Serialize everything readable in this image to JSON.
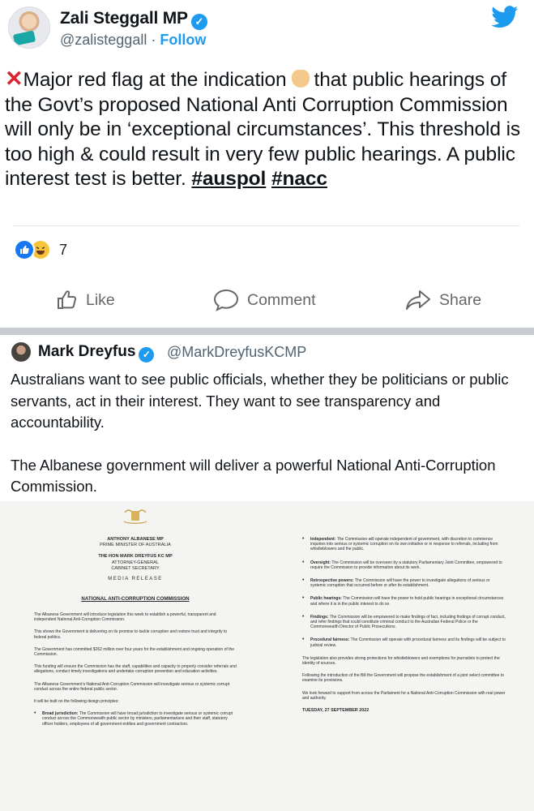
{
  "tweet1": {
    "author_name": "Zali Steggall MP",
    "handle": "@zalisteggall",
    "separator": "·",
    "follow_label": "Follow",
    "text_prefix": "Major red flag at the indication",
    "text_main": "that public hearings of the Govt’s proposed National Anti Corruption Commission will only be in ‘exceptional circumstances’. This threshold is too high & could result in very few public hearings. A public interest test is better.",
    "hashtag1": "#auspol",
    "hashtag2": "#nacc"
  },
  "reactions": {
    "count": "7"
  },
  "actions": {
    "like": "Like",
    "comment": "Comment",
    "share": "Share"
  },
  "tweet2": {
    "author_name": "Mark Dreyfus",
    "handle": "@MarkDreyfusKCMP",
    "paragraph1": "Australians want to see public officials, whether they be politicians or public servants, act in their interest. They want to see transparency and accountability.",
    "paragraph2": "The Albanese government will deliver a powerful National Anti-Corruption Commission."
  },
  "release": {
    "pm_name": "ANTHONY ALBANESE MP",
    "pm_title": "PRIME MINISTER OF AUSTRALIA",
    "ag_name": "THE HON MARK DREYFUS KC MP",
    "ag_title1": "ATTORNEY-GENERAL",
    "ag_title2": "CABINET SECRETARY",
    "media_release": "MEDIA RELEASE",
    "title": "NATIONAL ANTI-CORRUPTION COMMISSION",
    "left_paras": [
      "The Albanese Government will introduce legislation this week to establish a powerful, transparent and independent National Anti-Corruption Commission.",
      "This shows the Government is delivering on its promise to tackle corruption and restore trust and integrity to federal politics.",
      "The Government has committed $262 million over four years for the establishment and ongoing operation of the Commission.",
      "This funding will ensure the Commission has the staff, capabilities and capacity to properly consider referrals and allegations, conduct timely investigations and undertake corruption prevention and education activities.",
      "The Albanese Government’s National Anti-Corruption Commission will investigate serious or systemic corrupt conduct across the entire federal public sector.",
      "It will be built on the following design principles:"
    ],
    "left_bullet_label": "Broad jurisdiction:",
    "left_bullet_text": "The Commission will have broad jurisdiction to investigate serious or systemic corrupt conduct across the Commonwealth public sector by ministers, parliamentarians and their staff, statutory officer holders, employees of all government entities and government contractors.",
    "right_bullets": [
      {
        "label": "Independent:",
        "text": "The Commission will operate independent of government, with discretion to commence inquiries into serious or systemic corruption on its own initiative or in response to referrals, including from whistleblowers and the public."
      },
      {
        "label": "Oversight:",
        "text": "The Commission will be overseen by a statutory Parliamentary Joint Committee, empowered to require the Commission to provide information about its work."
      },
      {
        "label": "Retrospective powers:",
        "text": "The Commission will have the power to investigate allegations of serious or systemic corruption that occurred before or after its establishment."
      },
      {
        "label": "Public hearings:",
        "text": "The Commission will have the power to hold public hearings in exceptional circumstances and where it is in the public interest to do so."
      },
      {
        "label": "Findings:",
        "text": "The Commission will be empowered to make findings of fact, including findings of corrupt conduct, and refer findings that could constitute criminal conduct to the Australian Federal Police or the Commonwealth Director of Public Prosecutions."
      },
      {
        "label": "Procedural fairness:",
        "text": "The Commission will operate with procedural fairness and its findings will be subject to judicial review."
      }
    ],
    "right_paras": [
      "The legislation also provides strong protections for whistleblowers and exemptions for journalists to protect the identity of sources.",
      "Following the introduction of the Bill the Government will propose the establishment of a joint select committee to examine its provisions.",
      "We look forward to support from across the Parliament for a National Anti-Corruption Commission with real power and authority."
    ],
    "date": "TUESDAY, 27 SEPTEMBER 2022"
  },
  "colors": {
    "link": "#1d9bf0",
    "red_x": "#d7262e",
    "fb_blue": "#1877f2",
    "gray_text": "#65676b"
  }
}
